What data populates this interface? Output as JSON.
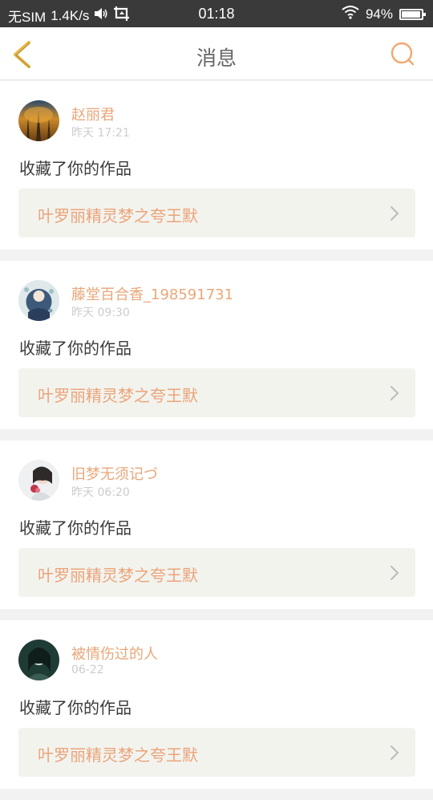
{
  "status_bar": {
    "carrier": "无SIM",
    "speed": "1.4K/s",
    "time": "01:18",
    "battery_percent_label": "94%",
    "battery_level": 0.94,
    "icons": [
      "speaker-icon",
      "screenshot-icon",
      "wifi-icon",
      "battery-icon"
    ]
  },
  "header": {
    "title": "消息",
    "back_icon": "chevron-left-icon",
    "search_icon": "search-icon"
  },
  "colors": {
    "accent": "#e8a77a",
    "back_arrow": "#e8b43c",
    "search_icon": "#f0a870",
    "work_bg": "#f3f3ee"
  },
  "notifications": [
    {
      "username": "赵丽君",
      "time": "昨天 17:21",
      "action": "收藏了你的作品",
      "work_title": "叶罗丽精灵梦之夸王默"
    },
    {
      "username": "藤堂百合香_198591731",
      "time": "昨天 09:30",
      "action": "收藏了你的作品",
      "work_title": "叶罗丽精灵梦之夸王默"
    },
    {
      "username": "旧梦无须记づ",
      "time": "昨天 06:20",
      "action": "收藏了你的作品",
      "work_title": "叶罗丽精灵梦之夸王默"
    },
    {
      "username": "被情伤过的人",
      "time": "06-22",
      "action": "收藏了你的作品",
      "work_title": "叶罗丽精灵梦之夸王默"
    }
  ]
}
